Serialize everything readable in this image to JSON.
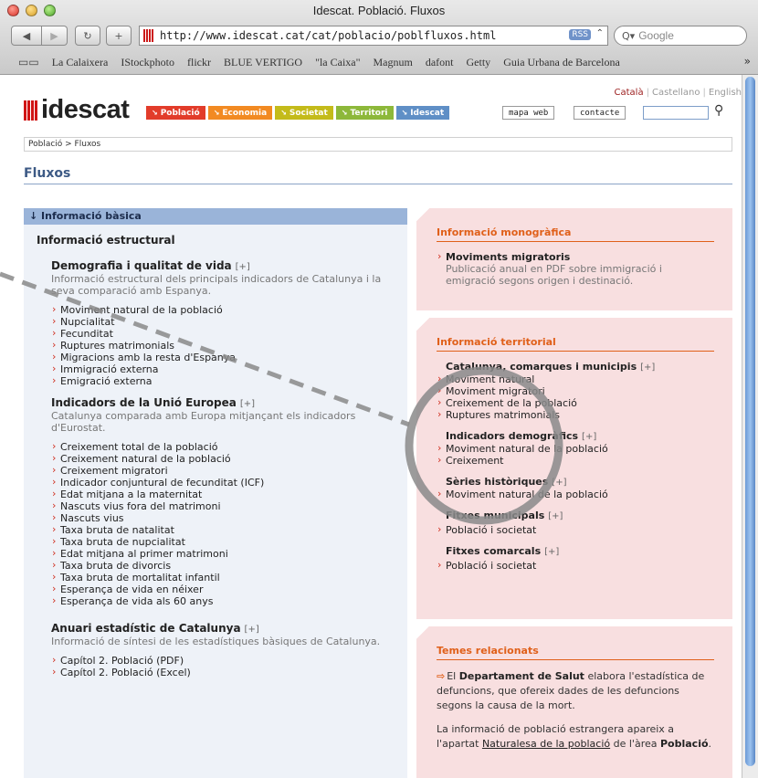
{
  "browser": {
    "window_title": "Idescat. Població. Fluxos",
    "url": "http://www.idescat.cat/cat/poblacio/poblfluxos.html",
    "rss_label": "RSS",
    "search_placeholder": "Google",
    "bookmarks": [
      "La Calaixera",
      "IStockphoto",
      "flickr",
      "BLUE VERTIGO",
      "\"la Caixa\"",
      "Magnum",
      "dafont",
      "Getty",
      "Guia Urbana de Barcelona"
    ],
    "bookmarks_more": "»"
  },
  "site": {
    "logo_text": "idescat",
    "languages": {
      "active": "Català",
      "other1": "Castellano",
      "other2": "English"
    },
    "menu": [
      "Població",
      "Economia",
      "Societat",
      "Territori",
      "Idescat"
    ],
    "mapa_web": "mapa web",
    "contacte": "contacte"
  },
  "breadcrumb": "Població > Fluxos",
  "page_title": "Fluxos",
  "left": {
    "section_header": "↓ Informació bàsica",
    "info_title": "Informació estructural",
    "groups": [
      {
        "title": "Demografia i qualitat de vida",
        "plus": "[+]",
        "desc": "Informació estructural dels principals indicadors de Catalunya i la seva comparació amb Espanya.",
        "items": [
          "Moviment natural de la població",
          "Nupcialitat",
          "Fecunditat",
          "Ruptures matrimonials",
          "Migracions amb la resta d'Espanya",
          "Immigració externa",
          "Emigració externa"
        ]
      },
      {
        "title": "Indicadors de la Unió Europea",
        "plus": "[+]",
        "desc": "Catalunya comparada amb Europa mitjançant els indicadors d'Eurostat.",
        "items": [
          "Creixement total de la població",
          "Creixement natural de la població",
          "Creixement migratori",
          "Indicador conjuntural de fecunditat (ICF)",
          "Edat mitjana a la maternitat",
          "Nascuts vius fora del matrimoni",
          "Nascuts vius",
          "Taxa bruta de natalitat",
          "Taxa bruta de nupcialitat",
          "Edat mitjana al primer matrimoni",
          "Taxa bruta de divorcis",
          "Taxa bruta de mortalitat infantil",
          "Esperança de vida en néixer",
          "Esperança de vida als 60 anys"
        ]
      },
      {
        "title": "Anuari estadístic de Catalunya",
        "plus": "[+]",
        "desc": "Informació de síntesi de les estadístiques bàsiques de Catalunya.",
        "items": [
          "Capítol 2. Població (PDF)",
          "Capítol 2. Població (Excel)"
        ]
      }
    ]
  },
  "right": {
    "monografica": {
      "title": "Informació monogràfica",
      "sub": "Moviments migratoris",
      "desc": "Publicació anual en PDF sobre immigració i emigració segons origen i destinació."
    },
    "territorial": {
      "title": "Informació territorial",
      "groups": [
        {
          "title": "Catalunya, comarques i municipis",
          "plus": "[+]",
          "items": [
            "Moviment natural",
            "Moviment migratori",
            "Creixement de la població",
            "Ruptures matrimonials"
          ]
        },
        {
          "title": "Indicadors demogràfics",
          "plus": "[+]",
          "items": [
            "Moviment natural de la població",
            "Creixement"
          ]
        },
        {
          "title": "Sèries històriques",
          "plus": "[+]",
          "items": [
            "Moviment natural de la població"
          ]
        },
        {
          "title": "Fitxes municipals",
          "plus": "[+]",
          "items": [
            "Població i societat"
          ]
        },
        {
          "title": "Fitxes comarcals",
          "plus": "[+]",
          "items": [
            "Població i societat"
          ]
        }
      ]
    },
    "temes": {
      "title": "Temes relacionats",
      "p1_pre": "El ",
      "p1_bold": "Departament de Salut",
      "p1_post": " elabora l'estadística de defuncions, que ofereix dades de les defuncions segons la causa de la mort.",
      "p2_pre": "La informació de població estrangera apareix a l'apartat ",
      "p2_link": "Naturalesa de la població",
      "p2_mid": " de l'àrea ",
      "p2_bold": "Població",
      "p2_end": "."
    }
  },
  "colors": {
    "accent_red": "#e23c2a",
    "accent_orange": "#f28a22",
    "accent_olive": "#c4bb1a",
    "accent_green": "#8db83a",
    "accent_blue": "#5f8fc6",
    "box_pink": "#f8dfe0",
    "left_bg": "#eef2f8",
    "section_blue": "#9ab4d9"
  }
}
